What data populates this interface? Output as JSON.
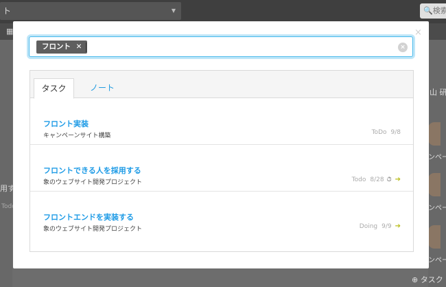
{
  "background": {
    "project_select": "ト",
    "search_placeholder": "検索",
    "side_right_snippet": "山 研",
    "side_right_texts": [
      "ンペー",
      "ンペー",
      "ンペー"
    ],
    "side_left_snippets": [
      "用す",
      "Todo"
    ],
    "footer_add_task": "⊕ タスク"
  },
  "modal": {
    "close_label": "×",
    "search": {
      "chip_label": "フロント",
      "chip_remove": "✕",
      "clear_label": "×"
    },
    "tabs": [
      {
        "label": "タスク",
        "active": true
      },
      {
        "label": "ノート",
        "active": false
      }
    ],
    "results": [
      {
        "title": "フロント実装",
        "subtitle": "キャンペーンサイト構築",
        "status": "ToDo",
        "date": "9/8",
        "icon": "",
        "arrow": ""
      },
      {
        "title": "フロントできる人を採用する",
        "subtitle": "象のウェブサイト開発プロジェクト",
        "status": "Todo",
        "date": "8/28",
        "icon": "⏱",
        "arrow": "➔"
      },
      {
        "title": "フロントエンドを実装する",
        "subtitle": "象のウェブサイト開発プロジェクト",
        "status": "Doing",
        "date": "9/9",
        "icon": "",
        "arrow": "➔"
      }
    ]
  },
  "colors": {
    "accent_blue": "#1e9be6",
    "focus_ring": "#47b9ec",
    "chip_bg": "#5f5f5f",
    "arrow": "#b9bd1c"
  }
}
